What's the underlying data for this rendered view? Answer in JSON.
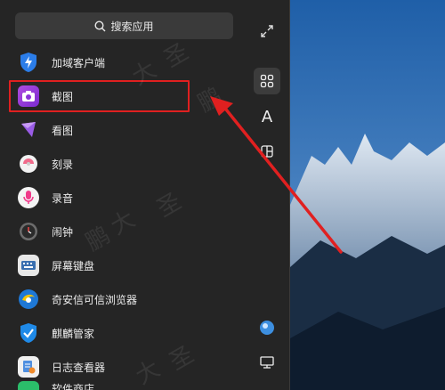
{
  "search": {
    "label": "搜索应用"
  },
  "apps": [
    {
      "name": "加域客户端",
      "icon": "shield-bolt-icon"
    },
    {
      "name": "截图",
      "icon": "screenshot-icon"
    },
    {
      "name": "看图",
      "icon": "image-viewer-icon"
    },
    {
      "name": "刻录",
      "icon": "burner-icon"
    },
    {
      "name": "录音",
      "icon": "microphone-icon"
    },
    {
      "name": "闹钟",
      "icon": "alarm-clock-icon"
    },
    {
      "name": "屏幕键盘",
      "icon": "keyboard-icon"
    },
    {
      "name": "奇安信可信浏览器",
      "icon": "browser-icon"
    },
    {
      "name": "麒麟管家",
      "icon": "shield-check-icon"
    },
    {
      "name": "日志查看器",
      "icon": "log-viewer-icon"
    },
    {
      "name": "软件商店",
      "icon": "store-icon"
    }
  ],
  "rail": {
    "letter_view": "A"
  },
  "watermark": {
    "chars": [
      "鹏",
      "大",
      "圣"
    ]
  },
  "colors": {
    "panel": "#252525",
    "highlight": "#e02020",
    "arrow": "#e02020"
  }
}
